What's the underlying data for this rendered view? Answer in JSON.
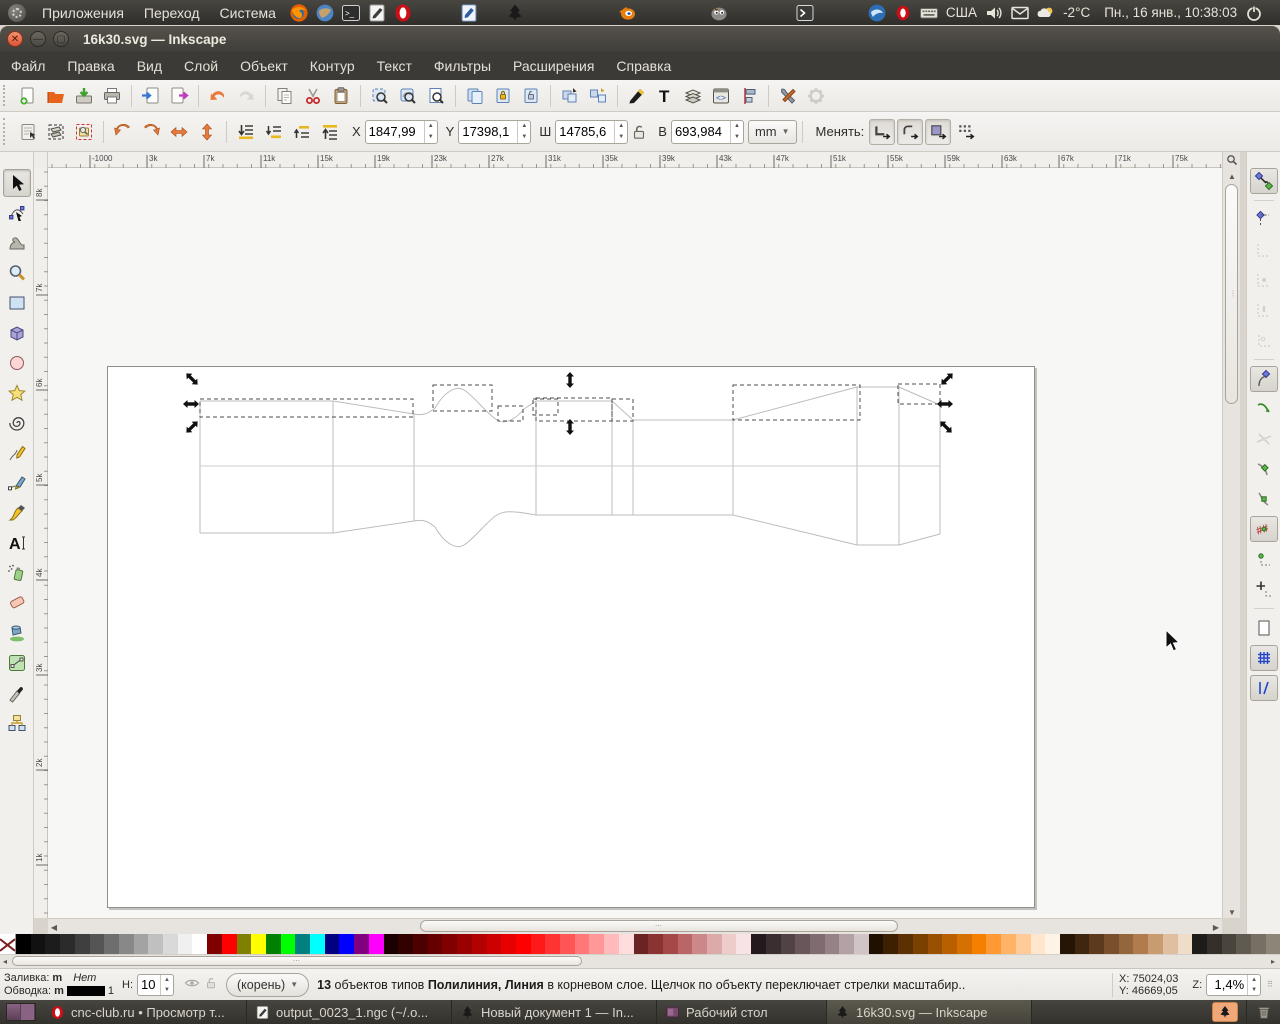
{
  "panel": {
    "menus": [
      "Приложения",
      "Переход",
      "Система"
    ],
    "launchers": [
      "firefox",
      "globe-browser",
      "terminal",
      "text-editor",
      "opera",
      "writer-document",
      "inkscape",
      "blender",
      "gimp",
      "terminal-2"
    ],
    "tray_icons": [
      "thunderbird",
      "opera-mini",
      "keyboard-indicator",
      "volume",
      "mail",
      "weather",
      "power"
    ],
    "keyboard_layout": "США",
    "temperature": "-2°C",
    "clock": "Пн., 16 янв., 10:38:03"
  },
  "window": {
    "title": "16k30.svg — Inkscape",
    "menubar": [
      "Файл",
      "Правка",
      "Вид",
      "Слой",
      "Объект",
      "Контур",
      "Текст",
      "Фильтры",
      "Расширения",
      "Справка"
    ]
  },
  "command_toolbar_icons": [
    "new-document",
    "open-document",
    "save-document",
    "print",
    "import",
    "export",
    "undo",
    "redo",
    "copy",
    "cut",
    "paste",
    "zoom-selection",
    "zoom-drawing",
    "zoom-page",
    "duplicate",
    "create-clone",
    "unlink-clone",
    "group",
    "ungroup",
    "fill-stroke-dialog",
    "text-dialog",
    "layers-dialog",
    "xml-editor",
    "align-dialog",
    "preferences",
    "input-devices"
  ],
  "tool_controls": {
    "select_icons": [
      "select-all",
      "select-all-layers",
      "deselect"
    ],
    "transform_icons": [
      "rotate-ccw",
      "rotate-cw",
      "flip-horizontal",
      "flip-vertical"
    ],
    "zorder_icons": [
      "lower-to-bottom",
      "lower",
      "raise",
      "raise-to-top"
    ],
    "x_label": "X",
    "x_value": "1847,99",
    "y_label": "Y",
    "y_value": "17398,1",
    "w_label": "Ш",
    "w_value": "14785,6",
    "h_label": "В",
    "h_value": "693,984",
    "unit": "mm",
    "affect_label": "Менять:",
    "affect_icons": [
      "scale-stroke",
      "scale-corners",
      "scale-gradient",
      "scale-pattern"
    ]
  },
  "rulers": {
    "h_labels": [
      "-1000",
      "3k",
      "7k",
      "11k",
      "15k",
      "19k",
      "23k",
      "27k",
      "31k",
      "35k",
      "39k",
      "43k",
      "47k",
      "51k",
      "55k",
      "59k",
      "63k",
      "67k",
      "71k",
      "75k"
    ],
    "v_labels": [
      "8k",
      "7k",
      "6k",
      "5k",
      "4k",
      "3k",
      "2k",
      "1k"
    ]
  },
  "toolbox_tools": [
    "selector",
    "node-editor",
    "tweak",
    "zoom",
    "rectangle",
    "box-3d",
    "ellipse",
    "star",
    "spiral",
    "pencil",
    "bezier-pen",
    "calligraphy",
    "text",
    "spray",
    "eraser",
    "paint-bucket",
    "gradient",
    "dropper",
    "connector"
  ],
  "snap_buttons": [
    "snap-enable",
    "snap-bbox",
    "snap-bbox-edges",
    "snap-bbox-corners",
    "snap-bbox-midpoints",
    "snap-bbox-centers",
    "snap-nodes",
    "snap-to-paths",
    "snap-path-intersections",
    "snap-cusp-nodes",
    "snap-smooth-nodes",
    "snap-midpoints",
    "snap-object-centers",
    "snap-rotation-center",
    "snap-page-border",
    "snap-grid",
    "snap-guides"
  ],
  "statusbar": {
    "fill_label": "Заливка:",
    "fill_flag": "m",
    "fill_value": "Нет",
    "stroke_label": "Обводка:",
    "stroke_flag": "m",
    "stroke_width": "1",
    "stroke_color": "#000000",
    "opacity_label": "Н:",
    "opacity_value": "10",
    "layer_button": "(корень)",
    "msg_count": "13",
    "msg_part1": " объектов типов ",
    "msg_bold1": "Полилиния,",
    "msg_part2": " ",
    "msg_bold2": "Линия",
    "msg_tail": " в корневом слое. Щелчок по объекту переключает стрелки масштабир..",
    "cursor_x_label": "X:",
    "cursor_x": "75024,03",
    "cursor_y_label": "Y:",
    "cursor_y": "46669,05",
    "zoom_label": "Z:",
    "zoom_value": "1,4%"
  },
  "palette": {
    "colors": [
      "none",
      "#000000",
      "#111111",
      "#1c1c1c",
      "#2b2b2b",
      "#3f3f3f",
      "#555555",
      "#6e6e6e",
      "#888888",
      "#a3a3a3",
      "#c0c0c0",
      "#d9d9d9",
      "#f0f0f0",
      "#ffffff",
      "#800000",
      "#ff0000",
      "#808000",
      "#ffff00",
      "#008000",
      "#00ff00",
      "#008080",
      "#00ffff",
      "#000080",
      "#0000ff",
      "#800080",
      "#ff00ff",
      "#1a0000",
      "#330000",
      "#4d0000",
      "#660000",
      "#800000",
      "#990000",
      "#b30000",
      "#cc0000",
      "#e60000",
      "#ff0000",
      "#ff1a1a",
      "#ff3333",
      "#ff5555",
      "#ff7777",
      "#ff9999",
      "#ffbbbb",
      "#ffdddd",
      "#6b2424",
      "#8a3333",
      "#a54848",
      "#bb6666",
      "#cc8888",
      "#ddaaaa",
      "#eecccc",
      "#f7e3e3",
      "#221a1c",
      "#3a2e31",
      "#514246",
      "#68565a",
      "#7f6b70",
      "#968186",
      "#b3a1a5",
      "#d0c4c7",
      "#1f1000",
      "#3d2000",
      "#5c3000",
      "#7a4000",
      "#995000",
      "#b86000",
      "#d67000",
      "#f58000",
      "#ff9933",
      "#ffb366",
      "#ffcc99",
      "#ffe6cc",
      "#fff3e6",
      "#241505",
      "#40250f",
      "#5c3a1e",
      "#78502d",
      "#94663c",
      "#b07c4b",
      "#c89b70",
      "#e0bfa0",
      "#f0ddc8",
      "#1e1c1a",
      "#343029",
      "#4a453c",
      "#605a50",
      "#767064",
      "#8c8678"
    ]
  },
  "taskbar": {
    "items": [
      {
        "icon": "opera",
        "label": "cnc-club.ru • Просмотр т..."
      },
      {
        "icon": "gedit",
        "label": "output_0023_1.ngc (~/.o..."
      },
      {
        "icon": "inkscape",
        "label": "Новый документ 1 — In..."
      },
      {
        "icon": "desktop",
        "label": "Рабочий стол"
      },
      {
        "icon": "inkscape",
        "label": "16k30.svg — Inkscape",
        "active": true
      }
    ],
    "tray_icons": [
      "inkscape-notification",
      "trash"
    ]
  }
}
